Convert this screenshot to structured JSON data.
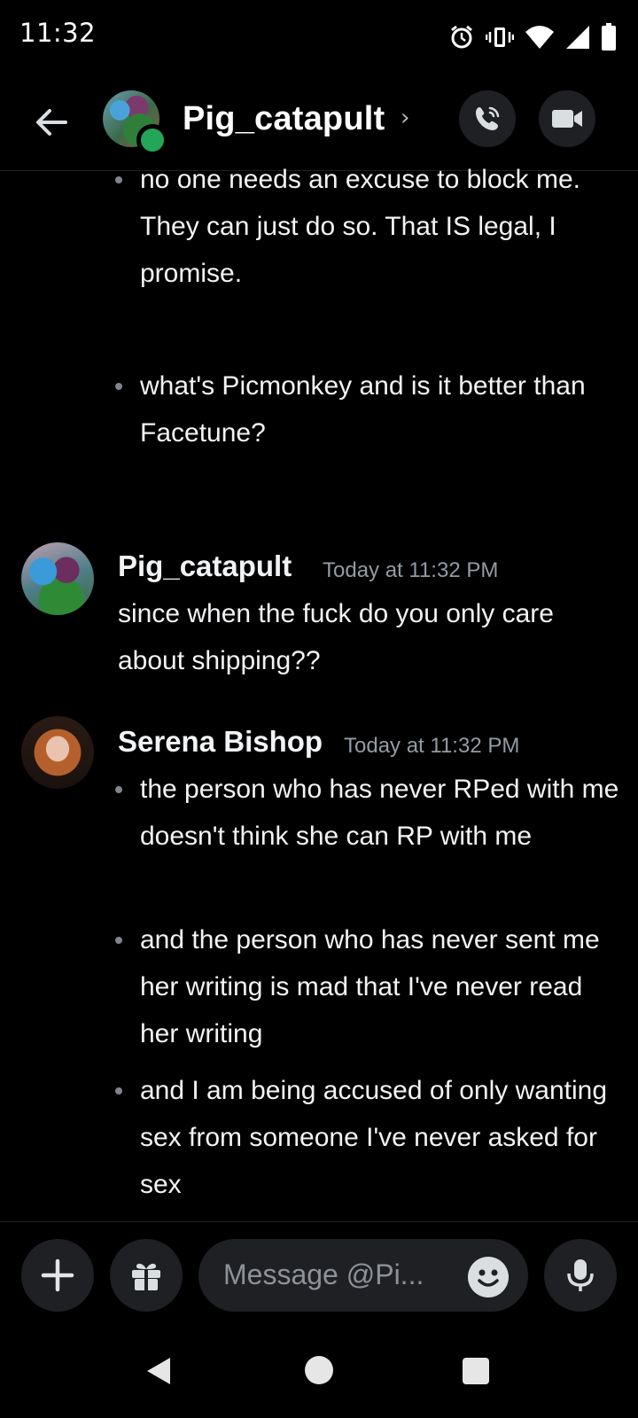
{
  "status_bar": {
    "time": "11:32",
    "icons": [
      "alarm-icon",
      "vibrate-icon",
      "wifi-icon",
      "cell-signal-icon",
      "battery-icon"
    ]
  },
  "header": {
    "back_icon": "arrow-left-icon",
    "title": "Pig_catapult",
    "chevron": "›",
    "online_status_color": "#23a55a",
    "actions": [
      "call-icon",
      "video-icon"
    ]
  },
  "messages": {
    "prior_bullets": [
      "no one needs an excuse to block me. They can just do so. That IS legal, I promise.",
      "what's Picmonkey and is it better than Facetune?"
    ],
    "group1": {
      "author": "Pig_catapult",
      "timestamp": "Today at 11:32 PM",
      "text": "since when the fuck do you only care about shipping??"
    },
    "group2": {
      "author": "Serena Bishop",
      "timestamp": "Today at 11:32 PM",
      "bullets": [
        "the person who has never RPed with me doesn't think she can RP with me",
        "and the person who has never sent me her writing is mad that I've never read her writing",
        "and I am being accused of only wanting sex from someone I've never asked for sex"
      ]
    }
  },
  "composer": {
    "placeholder": "Message @Pi...",
    "buttons": [
      "plus-icon",
      "gift-icon",
      "emoji-icon",
      "mic-icon"
    ]
  },
  "colors": {
    "background": "#000000",
    "surface": "#1f2024",
    "text": "#f2f3f5",
    "muted": "#949ba4"
  }
}
